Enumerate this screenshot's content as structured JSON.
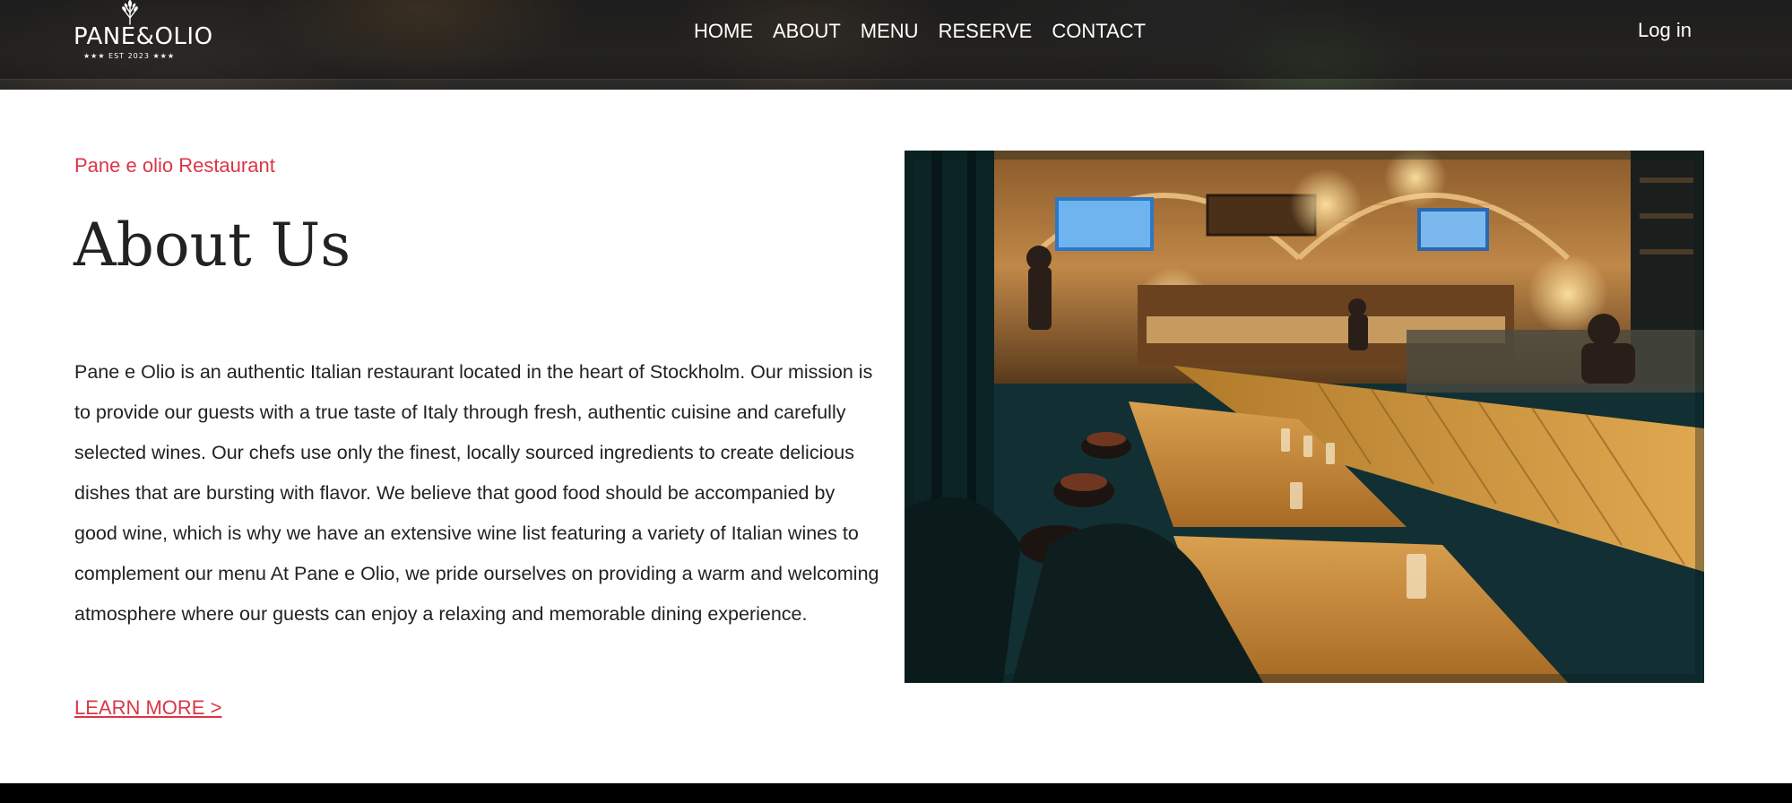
{
  "brand": {
    "logo_word": "PANE&OLIO",
    "logo_tagline": "★★★ EST 2023 ★★★",
    "logo_icon": "wheat-olive-branch-icon"
  },
  "nav": {
    "items": [
      {
        "label": "HOME"
      },
      {
        "label": "ABOUT"
      },
      {
        "label": "MENU"
      },
      {
        "label": "RESERVE"
      },
      {
        "label": "CONTACT"
      }
    ],
    "login_label": "Log in"
  },
  "about": {
    "eyebrow": "Pane e olio Restaurant",
    "title": "About Us",
    "body": "Pane e Olio is an authentic Italian restaurant located in the heart of Stockholm. Our mission is to provide our guests with a true taste of Italy through fresh, authentic cuisine and carefully selected wines. Our chefs use only the finest, locally sourced ingredients to create delicious dishes that are bursting with flavor. We believe that good food should be accompanied by good wine, which is why we have an extensive wine list featuring a variety of Italian wines to complement our menu At Pane e Olio, we pride ourselves on providing a warm and welcoming atmosphere where our guests can enjoy a relaxing and memorable dining experience.",
    "cta_label": "LEARN MORE >"
  },
  "colors": {
    "accent": "#dc3545",
    "text": "#222222",
    "header_bg": "#2c2b29",
    "footer_bg": "#000000"
  }
}
